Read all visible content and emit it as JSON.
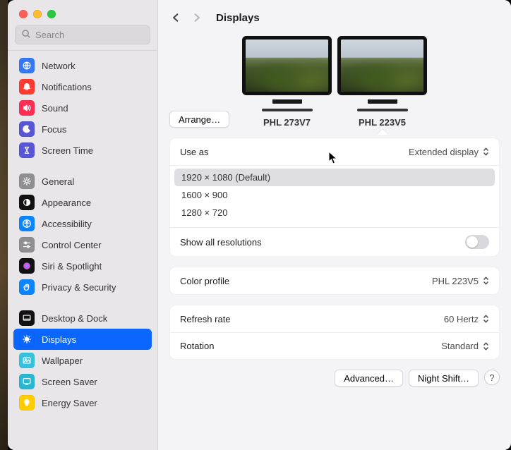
{
  "window": {
    "title": "Displays"
  },
  "search": {
    "placeholder": "Search"
  },
  "sidebar": {
    "items": [
      {
        "label": "Network",
        "icon": "globe",
        "bg": "#3478f6",
        "fg": "#fff"
      },
      {
        "label": "Notifications",
        "icon": "bell",
        "bg": "#ff3b30",
        "fg": "#fff"
      },
      {
        "label": "Sound",
        "icon": "speaker",
        "bg": "#ff2d55",
        "fg": "#fff"
      },
      {
        "label": "Focus",
        "icon": "moon",
        "bg": "#5856d6",
        "fg": "#fff"
      },
      {
        "label": "Screen Time",
        "icon": "hourglass",
        "bg": "#5856d6",
        "fg": "#fff"
      },
      {
        "label": "General",
        "icon": "gear",
        "bg": "#8e8e93",
        "fg": "#fff"
      },
      {
        "label": "Appearance",
        "icon": "appearance",
        "bg": "#111",
        "fg": "#fff"
      },
      {
        "label": "Accessibility",
        "icon": "accessibility",
        "bg": "#0a84ff",
        "fg": "#fff"
      },
      {
        "label": "Control Center",
        "icon": "sliders",
        "bg": "#8e8e93",
        "fg": "#fff"
      },
      {
        "label": "Siri & Spotlight",
        "icon": "siri",
        "bg": "#111",
        "fg": "#fff"
      },
      {
        "label": "Privacy & Security",
        "icon": "hand",
        "bg": "#0a84ff",
        "fg": "#fff"
      },
      {
        "label": "Desktop & Dock",
        "icon": "dock",
        "bg": "#111",
        "fg": "#fff"
      },
      {
        "label": "Displays",
        "icon": "brightness",
        "bg": "#0a66ff",
        "fg": "#fff",
        "selected": true
      },
      {
        "label": "Wallpaper",
        "icon": "wallpaper",
        "bg": "#34c2de",
        "fg": "#fff"
      },
      {
        "label": "Screen Saver",
        "icon": "screensaver",
        "bg": "#28b8d4",
        "fg": "#fff"
      },
      {
        "label": "Energy Saver",
        "icon": "bulb",
        "bg": "#ffcc00",
        "fg": "#fff"
      }
    ],
    "group_break_after": 4
  },
  "arrange_button": "Arrange…",
  "monitors": [
    {
      "name": "PHL 273V7",
      "selected": false
    },
    {
      "name": "PHL 223V5",
      "selected": true
    }
  ],
  "use_as": {
    "label": "Use as",
    "value": "Extended display"
  },
  "resolutions": [
    {
      "label": "1920 × 1080 (Default)",
      "selected": true
    },
    {
      "label": "1600 × 900",
      "selected": false
    },
    {
      "label": "1280 × 720",
      "selected": false
    }
  ],
  "show_all": {
    "label": "Show all resolutions",
    "on": false
  },
  "color_profile": {
    "label": "Color profile",
    "value": "PHL 223V5"
  },
  "refresh_rate": {
    "label": "Refresh rate",
    "value": "60 Hertz"
  },
  "rotation": {
    "label": "Rotation",
    "value": "Standard"
  },
  "footer": {
    "advanced": "Advanced…",
    "night_shift": "Night Shift…",
    "help": "?"
  }
}
